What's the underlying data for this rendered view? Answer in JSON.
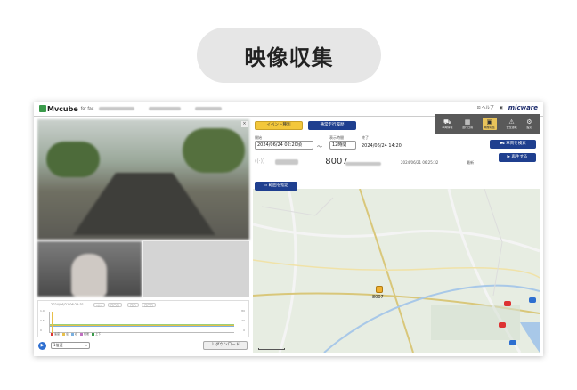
{
  "heading": "映像収集",
  "app": {
    "logo": "Mvcube",
    "logo_sub": "for fax",
    "brand": "micware",
    "user_hint": "ヘルプ"
  },
  "toolbar": {
    "event_button": "イベント種別",
    "travel_button": "通常走行履歴",
    "icons": [
      {
        "name": "vehicle-icon",
        "label": "車両情報"
      },
      {
        "name": "calendar-icon",
        "label": "運行日報"
      },
      {
        "name": "video-icon",
        "label": "映像収集"
      },
      {
        "name": "warning-icon",
        "label": "安全運転"
      },
      {
        "name": "settings-icon",
        "label": "設定"
      }
    ]
  },
  "search": {
    "start_label": "開始",
    "start_value": "2024/06/24 02:20頃",
    "tilde": "〜",
    "period_label": "表示時間",
    "period_value": "12時間",
    "end_label": "終了",
    "end_value": "2024/06/24 14:20",
    "vehicle_search_button": "車両を検索",
    "play_button": "再生する",
    "range_button": "範囲を指定"
  },
  "vehicle": {
    "number": "8007",
    "timestamp": "2024/06/21 06:25:32",
    "status": "最新"
  },
  "graph": {
    "timestamp": "2024/06/21 06:25:31",
    "legend": [
      "速度",
      "左",
      "右",
      "前後",
      "上下"
    ]
  },
  "player": {
    "speed": "1倍速",
    "download_button": "ダウンロード"
  },
  "map": {
    "marker_label": "8007"
  }
}
